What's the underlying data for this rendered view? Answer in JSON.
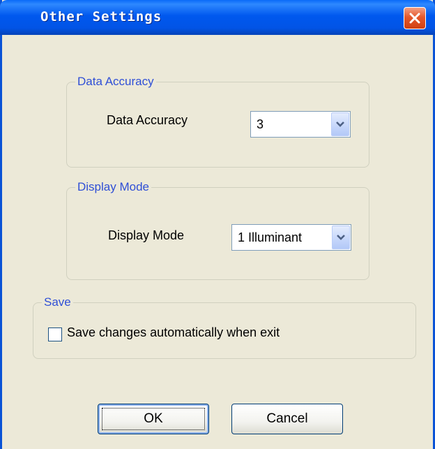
{
  "window": {
    "title": "Other Settings"
  },
  "data_accuracy": {
    "group_title": "Data Accuracy",
    "label": "Data Accuracy",
    "value": "3"
  },
  "display_mode": {
    "group_title": "Display Mode",
    "label": "Display Mode",
    "value": "1 Illuminant"
  },
  "save": {
    "group_title": "Save",
    "checkbox_label": "Save changes automatically when exit",
    "checked": false
  },
  "buttons": {
    "ok": "OK",
    "cancel": "Cancel"
  },
  "colors": {
    "titlebar": "#0058ee",
    "close": "#e5582b",
    "group_title": "#2f4fd6",
    "background": "#ece9d8"
  }
}
